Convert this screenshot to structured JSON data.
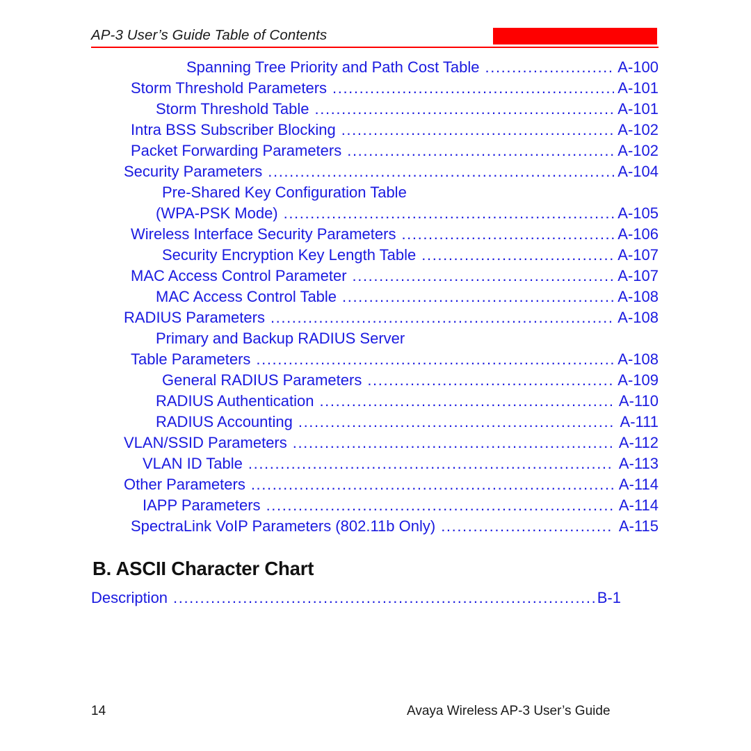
{
  "header": {
    "title": "AP-3 User’s Guide Table of Contents",
    "accent_color": "#fe0000",
    "rule_color": "#fe0000"
  },
  "toc": {
    "link_color": "#1a1ae0",
    "entries": [
      {
        "label": "Spanning Tree Priority and Path Cost Table",
        "page": "A-100",
        "indent": 5
      },
      {
        "label": "Storm Threshold Parameters",
        "page": "A-101",
        "indent": 1
      },
      {
        "label": "Storm Threshold Table",
        "page": "A-101",
        "indent": 3
      },
      {
        "label": "Intra BSS Subscriber Blocking",
        "page": "A-102",
        "indent": 1
      },
      {
        "label": "Packet Forwarding Parameters",
        "page": "A-102",
        "indent": 1
      },
      {
        "label": "Security Parameters",
        "page": "A-104",
        "indent": 0
      },
      {
        "label": "Pre-Shared Key Configuration Table",
        "page": "",
        "indent": 4,
        "wrap_first": true
      },
      {
        "label": "(WPA-PSK Mode)",
        "page": "A-105",
        "indent": 3
      },
      {
        "label": "Wireless Interface Security Parameters",
        "page": "A-106",
        "indent": 1
      },
      {
        "label": "Security Encryption Key Length Table",
        "page": "A-107",
        "indent": 4
      },
      {
        "label": "MAC Access Control Parameter",
        "page": "A-107",
        "indent": 1
      },
      {
        "label": "MAC Access Control Table",
        "page": "A-108",
        "indent": 3
      },
      {
        "label": "RADIUS Parameters",
        "page": "A-108",
        "indent": 0
      },
      {
        "label": "Primary and Backup RADIUS Server",
        "page": "",
        "indent": 3,
        "wrap_first": true
      },
      {
        "label": "Table Parameters",
        "page": "A-108",
        "indent": 1
      },
      {
        "label": "General RADIUS Parameters",
        "page": "A-109",
        "indent": 4
      },
      {
        "label": "RADIUS Authentication",
        "page": "A-110",
        "indent": 3
      },
      {
        "label": "RADIUS Accounting",
        "page": "A-111",
        "indent": 3
      },
      {
        "label": "VLAN/SSID Parameters",
        "page": "A-112",
        "indent": 0
      },
      {
        "label": "VLAN ID Table",
        "page": "A-113",
        "indent": 2
      },
      {
        "label": "Other Parameters",
        "page": "A-114",
        "indent": 0
      },
      {
        "label": "IAPP Parameters",
        "page": "A-114",
        "indent": 2
      },
      {
        "label": "SpectraLink VoIP Parameters (802.11b Only)",
        "page": "A-115",
        "indent": 1
      }
    ]
  },
  "section": {
    "heading": "B. ASCII Character Chart",
    "entries": [
      {
        "label": "Description",
        "page": "B-1",
        "indent": 0
      }
    ]
  },
  "footer": {
    "page_number": "14",
    "document_title": "Avaya Wireless AP-3 User’s Guide"
  }
}
